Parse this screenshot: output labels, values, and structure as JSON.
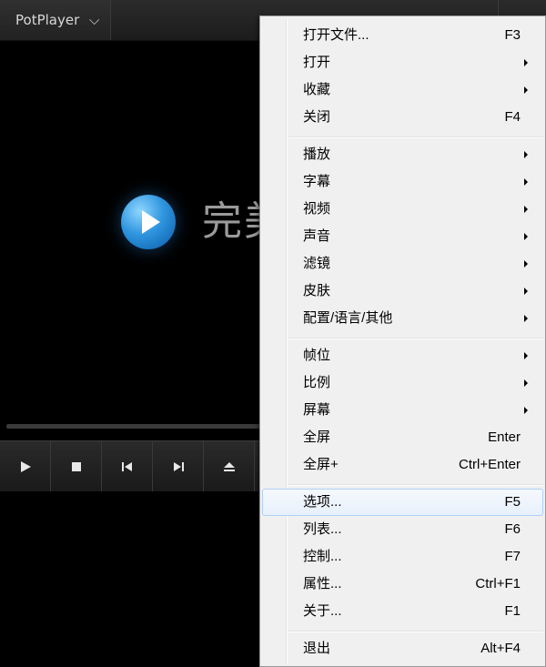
{
  "app": {
    "menu_label": "PotPlayer",
    "menu_chevron": "⌵",
    "logo_text": "完美"
  },
  "controls": [
    {
      "name": "play-icon"
    },
    {
      "name": "stop-icon"
    },
    {
      "name": "previous-icon"
    },
    {
      "name": "next-icon"
    },
    {
      "name": "eject-icon"
    }
  ],
  "menu": {
    "items": [
      {
        "label": "打开文件...",
        "shortcut": "F3"
      },
      {
        "label": "打开",
        "submenu": true
      },
      {
        "label": "收藏",
        "submenu": true
      },
      {
        "label": "关闭",
        "shortcut": "F4"
      },
      {
        "label": "播放",
        "submenu": true
      },
      {
        "label": "字幕",
        "submenu": true
      },
      {
        "label": "视频",
        "submenu": true
      },
      {
        "label": "声音",
        "submenu": true
      },
      {
        "label": "滤镜",
        "submenu": true
      },
      {
        "label": "皮肤",
        "submenu": true
      },
      {
        "label": "配置/语言/其他",
        "submenu": true
      },
      {
        "label": "帧位",
        "submenu": true
      },
      {
        "label": "比例",
        "submenu": true
      },
      {
        "label": "屏幕",
        "submenu": true
      },
      {
        "label": "全屏",
        "shortcut": "Enter"
      },
      {
        "label": "全屏+",
        "shortcut": "Ctrl+Enter"
      },
      {
        "label": "选项...",
        "shortcut": "F5",
        "highlighted": true
      },
      {
        "label": "列表...",
        "shortcut": "F6"
      },
      {
        "label": "控制...",
        "shortcut": "F7"
      },
      {
        "label": "属性...",
        "shortcut": "Ctrl+F1"
      },
      {
        "label": "关于...",
        "shortcut": "F1"
      },
      {
        "label": "退出",
        "shortcut": "Alt+F4"
      }
    ]
  }
}
